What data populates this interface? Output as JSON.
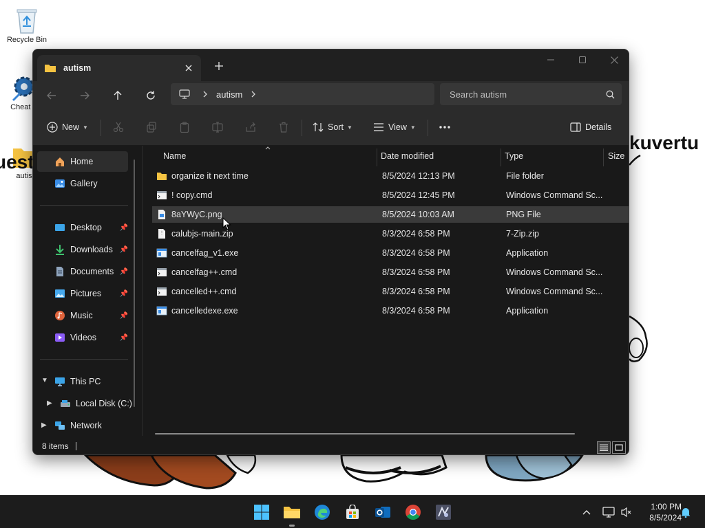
{
  "desktop": {
    "icons": [
      {
        "label": "Recycle Bin"
      },
      {
        "label": "Cheat E"
      },
      {
        "label": "autis"
      }
    ],
    "big_text_right": "kuvertu",
    "big_text_left": "uest"
  },
  "window": {
    "tab_title": "autism",
    "address": {
      "crumb": "autism"
    },
    "search": {
      "placeholder": "Search autism"
    },
    "toolbar": {
      "new_label": "New",
      "sort_label": "Sort",
      "view_label": "View",
      "details_label": "Details"
    },
    "sidebar": {
      "items": [
        {
          "label": "Home"
        },
        {
          "label": "Gallery"
        },
        {
          "label": "Desktop"
        },
        {
          "label": "Downloads"
        },
        {
          "label": "Documents"
        },
        {
          "label": "Pictures"
        },
        {
          "label": "Music"
        },
        {
          "label": "Videos"
        },
        {
          "label": "This PC"
        },
        {
          "label": "Local Disk (C:)"
        },
        {
          "label": "Network"
        }
      ]
    },
    "columns": {
      "name": "Name",
      "date": "Date modified",
      "type": "Type",
      "size": "Size"
    },
    "files": [
      {
        "name": "organize it next time",
        "date": "8/5/2024 12:13 PM",
        "type": "File folder",
        "icon": "folder-icon"
      },
      {
        "name": "! copy.cmd",
        "date": "8/5/2024 12:45 PM",
        "type": "Windows Command Sc...",
        "icon": "cmd-file-icon"
      },
      {
        "name": "8aYWyC.png",
        "date": "8/5/2024 10:03 AM",
        "type": "PNG File",
        "icon": "image-file-icon"
      },
      {
        "name": "calubjs-main.zip",
        "date": "8/3/2024 6:58 PM",
        "type": "7-Zip.zip",
        "icon": "zip-file-icon"
      },
      {
        "name": "cancelfag_v1.exe",
        "date": "8/3/2024 6:58 PM",
        "type": "Application",
        "icon": "exe-file-icon"
      },
      {
        "name": "cancelfag++.cmd",
        "date": "8/3/2024 6:58 PM",
        "type": "Windows Command Sc...",
        "icon": "cmd-file-icon"
      },
      {
        "name": "cancelled++.cmd",
        "date": "8/3/2024 6:58 PM",
        "type": "Windows Command Sc...",
        "icon": "cmd-file-icon"
      },
      {
        "name": "cancelledexe.exe",
        "date": "8/3/2024 6:58 PM",
        "type": "Application",
        "icon": "exe-file-icon"
      }
    ],
    "status": {
      "item_count": "8 items"
    }
  },
  "taskbar": {
    "clock": {
      "time": "1:00 PM",
      "date": "8/5/2024"
    }
  },
  "colors": {
    "accent": "#60cdff",
    "folder": "#f5c342",
    "window_bg": "#191919",
    "taskbar_bg": "#1c1c1c"
  }
}
